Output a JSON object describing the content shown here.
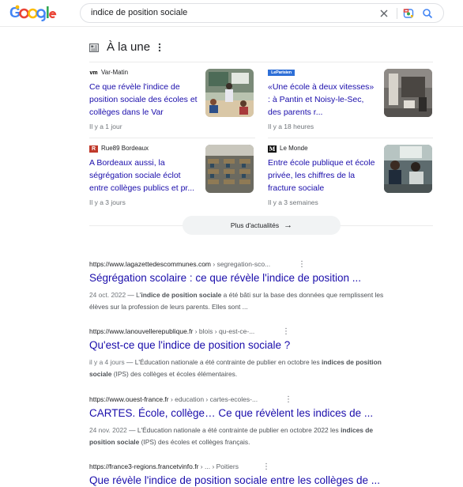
{
  "search": {
    "query": "indice de position sociale"
  },
  "top_stories": {
    "title": "À la une",
    "cards": [
      {
        "source_logo": "vm",
        "source": "Var-Matin",
        "headline": "Ce que révèle l'indice de position sociale des écoles et collèges dans le Var",
        "age": "Il y a 1 jour"
      },
      {
        "source_logo": "LeParisien",
        "source": "",
        "headline": "«Une école à deux vitesses» : à Pantin et Noisy-le-Sec, des parents r...",
        "age": "Il y a 18 heures"
      },
      {
        "source_logo": "R",
        "source": "Rue89 Bordeaux",
        "headline": "A Bordeaux aussi, la ségrégation sociale éclot entre collèges publics et pr...",
        "age": "Il y a 3 jours"
      },
      {
        "source_logo": "M",
        "source": "Le Monde",
        "headline": "Entre école publique et école privée, les chiffres de la fracture sociale",
        "age": "Il y a 3 semaines"
      }
    ],
    "more_label": "Plus d'actualités"
  },
  "results": [
    {
      "domain": "https://www.lagazettedescommunes.com",
      "path": " › segregation-sco...",
      "title": "Ségrégation scolaire : ce que révèle l'indice de position ...",
      "date": "24 oct. 2022",
      "snippet_pre": " — L'",
      "snippet_b1": "indice de position sociale",
      "snippet_mid": " a été bâti sur la base des données que remplissent les élèves sur la profession de leurs parents. Elles sont ...",
      "snippet_b2": "",
      "snippet_post": ""
    },
    {
      "domain": "https://www.lanouvellerepublique.fr",
      "path": " › blois › qu-est-ce-...",
      "title": "Qu'est-ce que l'indice de position sociale ?",
      "date": "il y a 4 jours",
      "snippet_pre": " — L'Éducation nationale a été contrainte de publier en octobre les ",
      "snippet_b1": "indices de position sociale",
      "snippet_mid": " (IPS) des collèges et écoles élémentaires.",
      "snippet_b2": "",
      "snippet_post": ""
    },
    {
      "domain": "https://www.ouest-france.fr",
      "path": " › education › cartes-ecoles-...",
      "title": "CARTES. École, collège… Ce que révèlent les indices de ...",
      "date": "24 nov. 2022",
      "snippet_pre": " — L'Éducation nationale a été contrainte de publier en octobre 2022 les ",
      "snippet_b1": "indices de position sociale",
      "snippet_mid": " (IPS) des écoles et collèges français.",
      "snippet_b2": "",
      "snippet_post": ""
    },
    {
      "domain": "https://france3-regions.francetvinfo.fr",
      "path": " › ... › Poitiers",
      "title": "Que révèle l'indice de position sociale entre les collèges de ...",
      "date": "",
      "snippet_pre": "",
      "snippet_b1": "",
      "snippet_mid": "",
      "snippet_b2": "",
      "snippet_post": ""
    }
  ],
  "colors": {
    "link": "#1a0dab",
    "muted": "#70757a",
    "snippet": "#4d5156",
    "border": "#ebebeb"
  },
  "icons": [
    "google-logo",
    "clear-icon",
    "lens-icon",
    "search-icon",
    "news-icon",
    "more-vert-icon",
    "arrow-right-icon"
  ]
}
